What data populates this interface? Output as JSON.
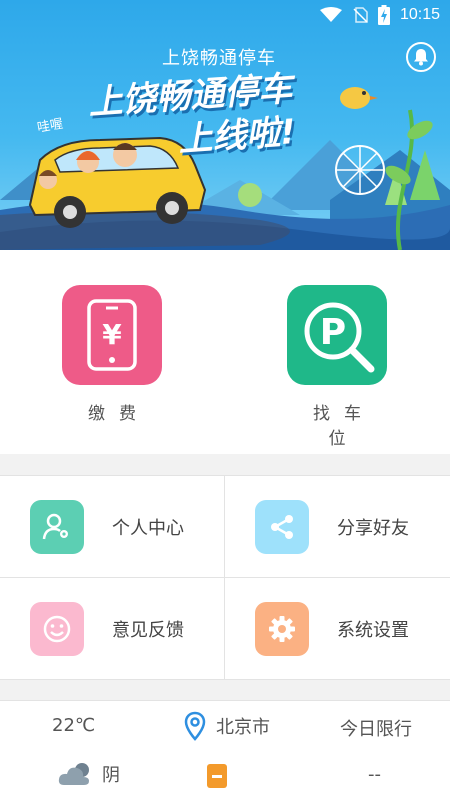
{
  "status_bar": {
    "time": "10:15"
  },
  "banner": {
    "title": "上饶畅通停车",
    "headline_line1": "上饶畅通停车",
    "headline_line2": "上线啦!",
    "bubble": "哇喔"
  },
  "actions": {
    "pay_label": "缴费",
    "find_spot_label": "找车位"
  },
  "menu": {
    "profile": "个人中心",
    "share": "分享好友",
    "feedback": "意见反馈",
    "settings": "系统设置"
  },
  "weather": {
    "temperature": "22℃",
    "city": "北京市",
    "restriction_title": "今日限行",
    "condition": "阴",
    "restriction_value": "--"
  },
  "colors": {
    "pay_tile": "#ee5b88",
    "park_tile": "#1fb889",
    "profile_icon": "#5ccfb3",
    "share_icon": "#9ee1fb",
    "feedback_icon": "#fbb9cf",
    "settings_icon": "#fbb183"
  }
}
